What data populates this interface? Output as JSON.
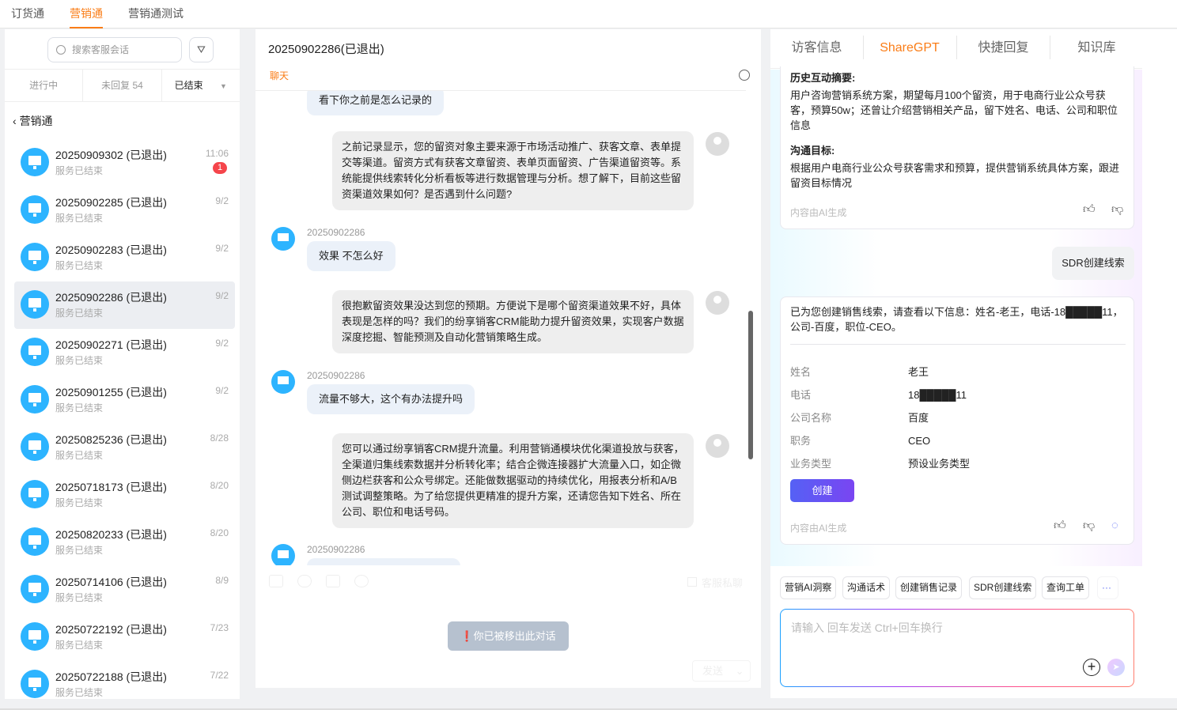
{
  "top_tabs": [
    {
      "label": "订货通"
    },
    {
      "label": "营销通"
    },
    {
      "label": "营销通测试"
    }
  ],
  "left": {
    "search_placeholder": "搜索客服会话",
    "status_tabs": [
      {
        "label": "进行中"
      },
      {
        "label": "未回复 54"
      },
      {
        "label": "已结束"
      }
    ],
    "back_label": "营销通",
    "conversations": [
      {
        "name": "20250909302 (已退出)",
        "sub": "服务已结束",
        "time": "11:06",
        "badge": "1"
      },
      {
        "name": "20250902285 (已退出)",
        "sub": "服务已结束",
        "time": "9/2"
      },
      {
        "name": "20250902283 (已退出)",
        "sub": "服务已结束",
        "time": "9/2"
      },
      {
        "name": "20250902286 (已退出)",
        "sub": "服务已结束",
        "time": "9/2"
      },
      {
        "name": "20250902271 (已退出)",
        "sub": "服务已结束",
        "time": "9/2"
      },
      {
        "name": "20250901255 (已退出)",
        "sub": "服务已结束",
        "time": "9/2"
      },
      {
        "name": "20250825236 (已退出)",
        "sub": "服务已结束",
        "time": "8/28"
      },
      {
        "name": "20250718173 (已退出)",
        "sub": "服务已结束",
        "time": "8/20"
      },
      {
        "name": "20250820233 (已退出)",
        "sub": "服务已结束",
        "time": "8/20"
      },
      {
        "name": "20250714106 (已退出)",
        "sub": "服务已结束",
        "time": "8/9"
      },
      {
        "name": "20250722192 (已退出)",
        "sub": "服务已结束",
        "time": "7/23"
      },
      {
        "name": "20250722188 (已退出)",
        "sub": "服务已结束",
        "time": "7/22"
      }
    ]
  },
  "chat": {
    "title": "20250902286(已退出)",
    "tab": "聊天",
    "messages": [
      {
        "text": "看下你之前是怎么记录的"
      },
      {
        "text": "之前记录显示，您的留资对象主要来源于市场活动推广、获客文章、表单提交等渠道。留资方式有获客文章留资、表单页面留资、广告渠道留资等。系统能提供线索转化分析看板等进行数据管理与分析。想了解下，目前这些留资渠道效果如何？是否遇到什么问题?"
      },
      {
        "sender": "20250902286",
        "text": "效果 不怎么好"
      },
      {
        "text": "很抱歉留资效果没达到您的预期。方便说下是哪个留资渠道效果不好，具体表现是怎样的吗？我们的纷享销客CRM能助力提升留资效果，实现客户数据深度挖掘、智能预测及自动化营销策略生成。"
      },
      {
        "sender": "20250902286",
        "text": "流量不够大，这个有办法提升吗"
      },
      {
        "text": "您可以通过纷享销客CRM提升流量。利用营销通模块优化渠道投放与获客，全渠道归集线索数据并分析转化率；结合企微连接器扩大流量入口，如企微侧边栏获客和公众号绑定。还能做数据驱动的持续优化，用报表分析和A/B测试调整策略。为了给您提供更精准的提升方案，还请您告知下姓名、所在公司、职位和电话号码。"
      },
      {
        "sender": "20250902286"
      }
    ],
    "private_label": "客服私聊",
    "kicked_notice": "你已被移出此对话",
    "send_label": "发送"
  },
  "right": {
    "tabs": [
      {
        "label": "访客信息"
      },
      {
        "label": "ShareGPT"
      },
      {
        "label": "快捷回复"
      },
      {
        "label": "知识库"
      }
    ],
    "summary": {
      "h1": "历史互动摘要:",
      "p1": "用户咨询营销系统方案，期望每月100个留资，用于电商行业公众号获客，预算50w；还曾让介绍营销相关产品，留下姓名、电话、公司和职位信息",
      "h2": "沟通目标:",
      "p2": "根据用户电商行业公众号获客需求和预算，提供营销系统具体方案，跟进留资目标情况",
      "ai_note": "内容由AI生成"
    },
    "user_query": "SDR创建线索",
    "lead": {
      "text": "已为您创建销售线索，请查看以下信息：姓名-老王，电话-18█████11，公司-百度，职位-CEO。",
      "fields": [
        {
          "label": "姓名",
          "value": "老王"
        },
        {
          "label": "电话",
          "value": "18█████11"
        },
        {
          "label": "公司名称",
          "value": "百度"
        },
        {
          "label": "职务",
          "value": "CEO"
        },
        {
          "label": "业务类型",
          "value": "预设业务类型"
        }
      ],
      "create_label": "创建",
      "ai_note": "内容由AI生成"
    },
    "quick_actions": [
      {
        "label": "营销AI洞察"
      },
      {
        "label": "沟通话术"
      },
      {
        "label": "创建销售记录"
      },
      {
        "label": "SDR创建线索"
      },
      {
        "label": "查询工单"
      },
      {
        "label": "···"
      }
    ],
    "input_placeholder": "请输入 回车发送 Ctrl+回车换行"
  }
}
